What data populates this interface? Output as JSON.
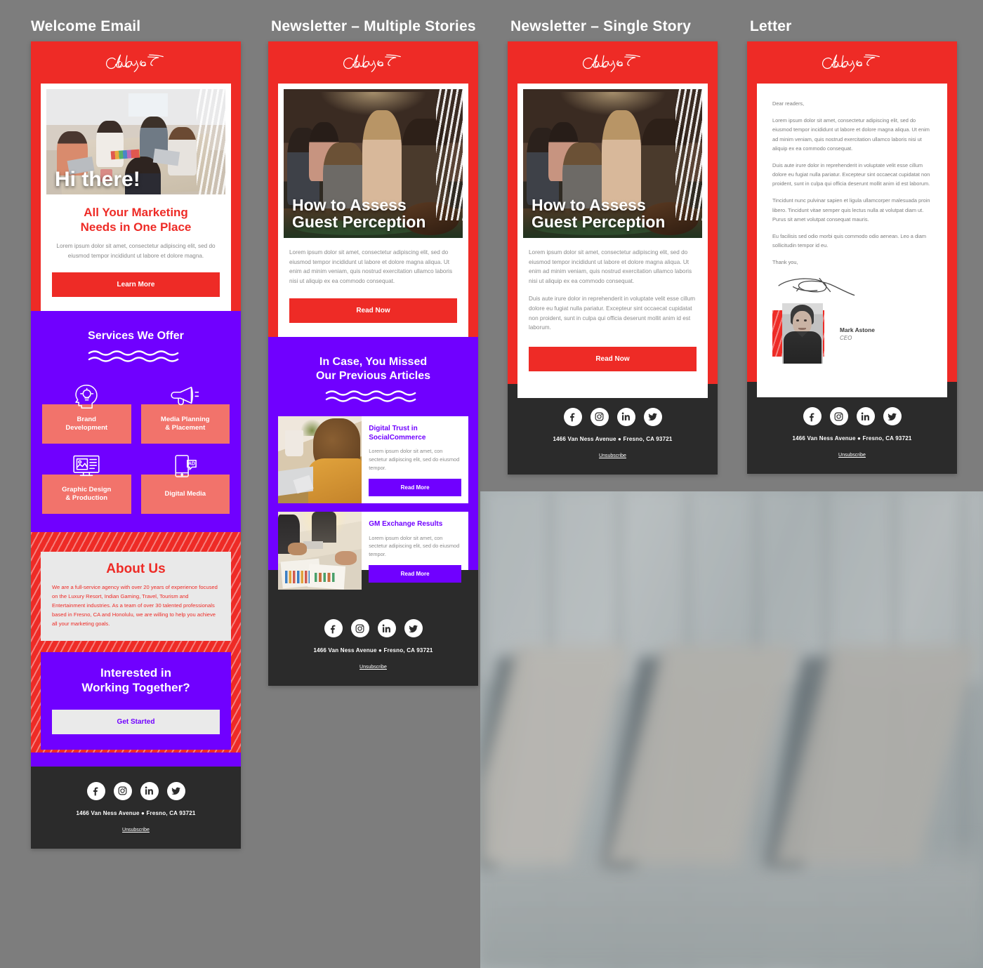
{
  "brand": {
    "logo_text": "Catalyst",
    "colors": {
      "red": "#EE2B26",
      "purple": "#7000FF",
      "salmon": "#F2736B",
      "dark": "#2B2B2B",
      "light_gray": "#E9E9E9"
    }
  },
  "columns": [
    {
      "title": "Welcome Email"
    },
    {
      "title": "Newsletter – Multiple Stories"
    },
    {
      "title": "Newsletter – Single Story"
    },
    {
      "title": "Letter"
    }
  ],
  "welcome": {
    "hero_title": "Hi there!",
    "headline": "All Your Marketing\nNeeds in One Place",
    "headline_l1": "All Your Marketing",
    "headline_l2": "Needs in One Place",
    "body": "Lorem ipsum dolor sit amet, consectetur adipiscing elit, sed do eiusmod tempor incididunt ut labore et dolore magna.",
    "cta_label": "Learn More",
    "services_title_l1": "Services We Offer",
    "services": [
      {
        "label_l1": "Brand",
        "label_l2": "Development",
        "icon": "head-lightbulb-icon"
      },
      {
        "label_l1": "Media Planning",
        "label_l2": "& Placement",
        "icon": "megaphone-icon"
      },
      {
        "label_l1": "Graphic Design",
        "label_l2": "& Production",
        "icon": "monitor-design-icon"
      },
      {
        "label_l1": "Digital Media",
        "label_l2": "",
        "icon": "mobile-ad-icon"
      }
    ],
    "about_title": "About Us",
    "about_body": "We are a full-service agency with over 20 years of experience focused on the Luxury Resort, Indian Gaming, Travel, Tourism and Entertainment industries. As a team of over 30 talented professionals based in Fresno, CA and Honolulu, we are willing to help you achieve all your marketing goals.",
    "cta2_l1": "Interested in",
    "cta2_l2": "Working Together?",
    "cta2_label": "Get Started"
  },
  "newsletter_multi": {
    "hero_title_l1": "How to Assess",
    "hero_title_l2": "Guest Perception",
    "body": "Lorem ipsum dolor sit amet, consectetur adipiscing elit, sed do eiusmod tempor incididunt ut labore et dolore magna aliqua. Ut enim ad minim veniam, quis nostrud exercitation ullamco laboris nisi ut aliquip ex ea commodo consequat.",
    "cta_label": "Read Now",
    "section_title_l1": "In Case, You Missed",
    "section_title_l2": "Our Previous Articles",
    "articles": [
      {
        "title_l1": "Digital Trust in",
        "title_l2": "SocialCommerce",
        "body": "Lorem ipsum dolor sit amet, con sectetur adipiscing elit, sed do eiusmod tempor.",
        "cta_label": "Read More"
      },
      {
        "title_l1": "GM Exchange Results",
        "title_l2": "",
        "body": "Lorem ipsum dolor sit amet, con sectetur adipiscing elit, sed do eiusmod tempor.",
        "cta_label": "Read More"
      }
    ]
  },
  "newsletter_single": {
    "hero_title_l1": "How to Assess",
    "hero_title_l2": "Guest Perception",
    "para1": "Lorem ipsum dolor sit amet, consectetur adipiscing elit, sed do eiusmod tempor incididunt ut labore et dolore magna aliqua. Ut enim ad minim veniam, quis nostrud exercitation ullamco laboris nisi ut aliquip ex ea commodo consequat.",
    "para2": "Duis aute irure dolor in reprehenderit in voluptate velit esse cillum dolore eu fugiat nulla pariatur. Excepteur sint occaecat cupidatat non proident, sunt in culpa qui officia deserunt mollit anim id est laborum.",
    "cta_label": "Read Now"
  },
  "letter": {
    "salutation": "Dear readers,",
    "para1": "Lorem ipsum dolor sit amet, consectetur adipiscing elit, sed do eiusmod tempor incididunt ut labore et dolore magna aliqua. Ut enim ad minim veniam, quis nostrud exercitation ullamco laboris nisi ut aliquip ex ea commodo consequat.",
    "para2": "Duis aute irure dolor in reprehenderit in voluptate velit esse cillum dolore eu fugiat nulla pariatur. Excepteur sint occaecat cupidatat non proident, sunt in culpa qui officia deserunt mollit anim id est laborum.",
    "para3": "Tincidunt nunc pulvinar sapien et ligula ullamcorper malesuada proin libero. Tincidunt vitae semper quis lectus nulla at volutpat diam ut. Purus sit amet volutpat consequat mauris.",
    "para4": "Eu facilisis sed odio morbi quis commodo odio aenean. Leo a diam sollicitudin tempor id eu.",
    "closing": "Thank you,",
    "signer_name": "Mark Astone",
    "signer_role": "CEO"
  },
  "footer": {
    "address": "1466 Van Ness Avenue  ●  Fresno, CA 93721",
    "unsubscribe": "Unsubscribe",
    "socials": [
      "facebook-icon",
      "instagram-icon",
      "linkedin-icon",
      "twitter-icon"
    ]
  }
}
